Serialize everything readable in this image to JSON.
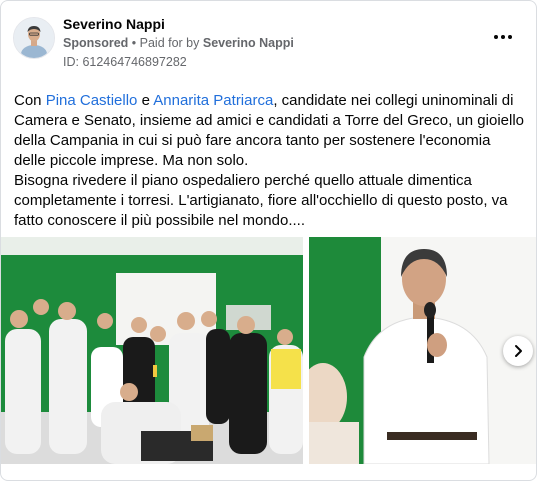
{
  "post": {
    "page_name": "Severino Nappi",
    "sponsored_label": "Sponsored",
    "separator": " • ",
    "paid_for_prefix": "Paid for by ",
    "paid_for_by": "Severino Nappi",
    "ad_id": "ID: 612464746897282",
    "text": {
      "p1_a": "Con ",
      "mention1": "Pina Castiello",
      "p1_b": " e ",
      "mention2": "Annarita Patriarca",
      "p1_c": ", candidate nei collegi uninominali di Camera e Senato, insieme ad amici e candidati a Torre del Greco, un gioiello della Campania in cui si può fare ancora tanto per sostenere l'economia delle piccole imprese. Ma non solo.",
      "p2": "Bisogna rivedere il piano ospedaliero perché quello attuale dimentica completamente i torresi. L'artigianato, fiore all'occhiello di questo posto, va fatto conoscere il più possibile nel mondo...."
    }
  },
  "colors": {
    "link": "#216fdb",
    "meta": "#65676b",
    "green_wall": "#1f8a3a"
  },
  "icons": {
    "more": "more-horizontal-icon",
    "next": "chevron-right-icon"
  }
}
